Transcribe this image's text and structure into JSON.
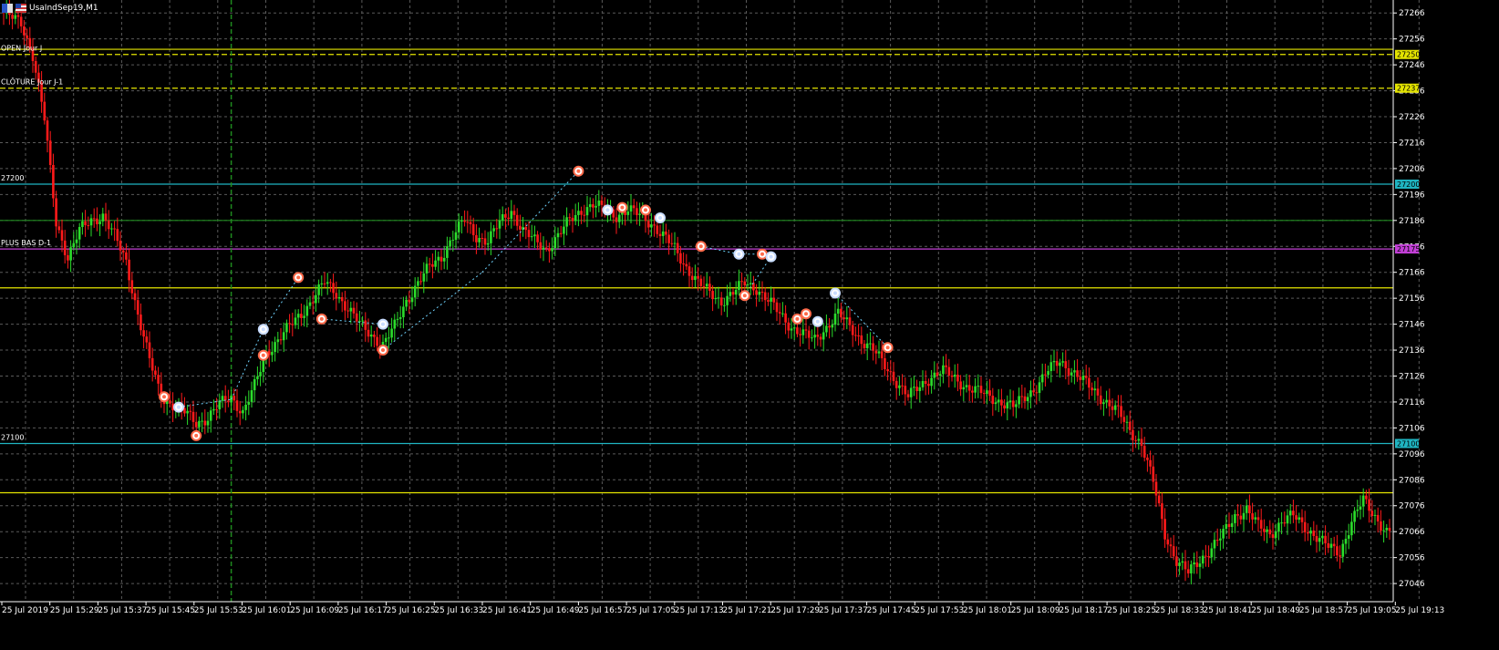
{
  "window": {
    "symbol_title": "UsaIndSep19,M1"
  },
  "colors": {
    "background": "#000000",
    "grid": "#5a5a5a",
    "axis_text": "#ffffff",
    "bull": "#2bdc2b",
    "bear": "#ff1a1a",
    "level_yellow": "#e5e500",
    "level_cyan": "#1fb5c2",
    "level_magenta": "#c23fd6",
    "level_green": "#1f8a1f",
    "marker_buy": "#c8dcff",
    "marker_sell": "#ff6a4a",
    "trade_line": "#6fd4ff"
  },
  "chart_data": {
    "type": "candlestick",
    "instrument": "UsaIndSep19",
    "timeframe": "M1",
    "ylim": [
      27039,
      27271
    ],
    "y_ticks": [
      "27266",
      "27256",
      "27246",
      "27236",
      "27226",
      "27216",
      "27206",
      "27196",
      "27186",
      "27176",
      "27166",
      "27156",
      "27146",
      "27136",
      "27126",
      "27116",
      "27106",
      "27096",
      "27086",
      "27076",
      "27066",
      "27056",
      "27046"
    ],
    "x_ticks": [
      "25 Jul 2019",
      "25 Jul 15:29",
      "25 Jul 15:37",
      "25 Jul 15:45",
      "25 Jul 15:53",
      "25 Jul 16:01",
      "25 Jul 16:09",
      "25 Jul 16:17",
      "25 Jul 16:25",
      "25 Jul 16:33",
      "25 Jul 16:41",
      "25 Jul 16:49",
      "25 Jul 16:57",
      "25 Jul 17:05",
      "25 Jul 17:13",
      "25 Jul 17:21",
      "25 Jul 17:29",
      "25 Jul 17:37",
      "25 Jul 17:45",
      "25 Jul 17:53",
      "25 Jul 18:01",
      "25 Jul 18:09",
      "25 Jul 18:17",
      "25 Jul 18:25",
      "25 Jul 18:33",
      "25 Jul 18:41",
      "25 Jul 18:49",
      "25 Jul 18:57",
      "25 Jul 19:05",
      "25 Jul 19:13"
    ],
    "close_anchors": [
      [
        0,
        27266
      ],
      [
        6,
        27262
      ],
      [
        10,
        27250
      ],
      [
        14,
        27225
      ],
      [
        18,
        27185
      ],
      [
        22,
        27172
      ],
      [
        26,
        27182
      ],
      [
        30,
        27186
      ],
      [
        34,
        27188
      ],
      [
        38,
        27180
      ],
      [
        42,
        27170
      ],
      [
        46,
        27150
      ],
      [
        50,
        27132
      ],
      [
        54,
        27118
      ],
      [
        58,
        27115
      ],
      [
        62,
        27112
      ],
      [
        66,
        27108
      ],
      [
        70,
        27110
      ],
      [
        74,
        27115
      ],
      [
        78,
        27118
      ],
      [
        82,
        27112
      ],
      [
        86,
        27122
      ],
      [
        90,
        27135
      ],
      [
        94,
        27140
      ],
      [
        98,
        27145
      ],
      [
        102,
        27150
      ],
      [
        106,
        27156
      ],
      [
        110,
        27162
      ],
      [
        114,
        27158
      ],
      [
        118,
        27152
      ],
      [
        122,
        27146
      ],
      [
        126,
        27142
      ],
      [
        130,
        27138
      ],
      [
        134,
        27145
      ],
      [
        138,
        27155
      ],
      [
        142,
        27162
      ],
      [
        146,
        27168
      ],
      [
        150,
        27172
      ],
      [
        154,
        27180
      ],
      [
        158,
        27186
      ],
      [
        162,
        27180
      ],
      [
        166,
        27178
      ],
      [
        170,
        27185
      ],
      [
        174,
        27190
      ],
      [
        178,
        27182
      ],
      [
        182,
        27178
      ],
      [
        186,
        27175
      ],
      [
        190,
        27180
      ],
      [
        194,
        27186
      ],
      [
        198,
        27190
      ],
      [
        202,
        27192
      ],
      [
        206,
        27190
      ],
      [
        210,
        27188
      ],
      [
        214,
        27190
      ],
      [
        218,
        27188
      ],
      [
        222,
        27185
      ],
      [
        226,
        27180
      ],
      [
        230,
        27175
      ],
      [
        234,
        27168
      ],
      [
        238,
        27162
      ],
      [
        242,
        27158
      ],
      [
        246,
        27155
      ],
      [
        250,
        27158
      ],
      [
        254,
        27162
      ],
      [
        258,
        27160
      ],
      [
        262,
        27155
      ],
      [
        266,
        27150
      ],
      [
        270,
        27145
      ],
      [
        274,
        27142
      ],
      [
        278,
        27140
      ],
      [
        282,
        27145
      ],
      [
        286,
        27150
      ],
      [
        290,
        27145
      ],
      [
        294,
        27140
      ],
      [
        298,
        27136
      ],
      [
        302,
        27130
      ],
      [
        306,
        27124
      ],
      [
        310,
        27118
      ],
      [
        314,
        27122
      ],
      [
        318,
        27126
      ],
      [
        322,
        27128
      ],
      [
        326,
        27125
      ],
      [
        330,
        27122
      ],
      [
        334,
        27120
      ],
      [
        338,
        27118
      ],
      [
        342,
        27116
      ],
      [
        346,
        27114
      ],
      [
        350,
        27118
      ],
      [
        354,
        27122
      ],
      [
        358,
        27128
      ],
      [
        362,
        27132
      ],
      [
        366,
        27128
      ],
      [
        370,
        27124
      ],
      [
        374,
        27120
      ],
      [
        378,
        27116
      ],
      [
        382,
        27112
      ],
      [
        386,
        27105
      ],
      [
        390,
        27100
      ],
      [
        394,
        27085
      ],
      [
        398,
        27065
      ],
      [
        402,
        27055
      ],
      [
        406,
        27050
      ],
      [
        410,
        27055
      ],
      [
        414,
        27060
      ],
      [
        418,
        27065
      ],
      [
        422,
        27072
      ],
      [
        426,
        27075
      ],
      [
        430,
        27068
      ],
      [
        434,
        27065
      ],
      [
        438,
        27070
      ],
      [
        442,
        27072
      ],
      [
        446,
        27068
      ],
      [
        450,
        27064
      ],
      [
        454,
        27060
      ],
      [
        458,
        27058
      ],
      [
        462,
        27070
      ],
      [
        466,
        27078
      ],
      [
        470,
        27072
      ],
      [
        474,
        27066
      ]
    ],
    "horizontal_levels": [
      {
        "label": "OPEN Jour J",
        "price": 27250,
        "price_tag": "27250",
        "color": "yellow",
        "style": "dash"
      },
      {
        "label": "",
        "price": 27252,
        "price_tag": "",
        "color": "yellow",
        "style": "solid"
      },
      {
        "label": "CLÔTURE Jour J-1",
        "price": 27237,
        "price_tag": "27237",
        "color": "yellow",
        "style": "dash"
      },
      {
        "label": "27200",
        "price": 27200,
        "price_tag": "27200",
        "color": "cyan",
        "style": "solid"
      },
      {
        "label": "",
        "price": 27186,
        "price_tag": "",
        "color": "green",
        "style": "solid"
      },
      {
        "label": "PLUS BAS D-1",
        "price": 27175,
        "price_tag": "27175",
        "color": "magenta",
        "style": "solid"
      },
      {
        "label": "",
        "price": 27160,
        "price_tag": "",
        "color": "yellow",
        "style": "solid"
      },
      {
        "label": "27100",
        "price": 27100,
        "price_tag": "27100",
        "color": "cyan",
        "style": "solid"
      },
      {
        "label": "",
        "price": 27081,
        "price_tag": "",
        "color": "yellow",
        "style": "solid"
      }
    ],
    "vertical_line_time_index": 78,
    "trade_markers": [
      {
        "i": 55,
        "price": 27118,
        "kind": "sell"
      },
      {
        "i": 60,
        "price": 27114,
        "kind": "buy"
      },
      {
        "i": 66,
        "price": 27103,
        "kind": "sell"
      },
      {
        "i": 89,
        "price": 27134,
        "kind": "sell"
      },
      {
        "i": 89,
        "price": 27144,
        "kind": "buy"
      },
      {
        "i": 101,
        "price": 27164,
        "kind": "sell"
      },
      {
        "i": 109,
        "price": 27148,
        "kind": "sell"
      },
      {
        "i": 130,
        "price": 27146,
        "kind": "buy"
      },
      {
        "i": 130,
        "price": 27136,
        "kind": "sell"
      },
      {
        "i": 197,
        "price": 27205,
        "kind": "sell"
      },
      {
        "i": 207,
        "price": 27190,
        "kind": "buy"
      },
      {
        "i": 212,
        "price": 27191,
        "kind": "sell"
      },
      {
        "i": 220,
        "price": 27190,
        "kind": "sell"
      },
      {
        "i": 225,
        "price": 27187,
        "kind": "buy"
      },
      {
        "i": 239,
        "price": 27176,
        "kind": "sell"
      },
      {
        "i": 252,
        "price": 27173,
        "kind": "buy"
      },
      {
        "i": 254,
        "price": 27157,
        "kind": "sell"
      },
      {
        "i": 260,
        "price": 27173,
        "kind": "sell"
      },
      {
        "i": 263,
        "price": 27172,
        "kind": "buy"
      },
      {
        "i": 272,
        "price": 27148,
        "kind": "sell"
      },
      {
        "i": 275,
        "price": 27150,
        "kind": "sell"
      },
      {
        "i": 279,
        "price": 27147,
        "kind": "buy"
      },
      {
        "i": 285,
        "price": 27158,
        "kind": "buy"
      },
      {
        "i": 303,
        "price": 27137,
        "kind": "sell"
      }
    ],
    "trade_links": [
      [
        60,
        27114,
        78,
        27117
      ],
      [
        78,
        27117,
        89,
        27144
      ],
      [
        89,
        27144,
        101,
        27164
      ],
      [
        109,
        27148,
        130,
        27146
      ],
      [
        130,
        27136,
        164,
        27166
      ],
      [
        164,
        27166,
        197,
        27205
      ],
      [
        239,
        27176,
        252,
        27173
      ],
      [
        252,
        27173,
        260,
        27173
      ],
      [
        254,
        27157,
        263,
        27172
      ],
      [
        285,
        27158,
        303,
        27137
      ]
    ]
  }
}
